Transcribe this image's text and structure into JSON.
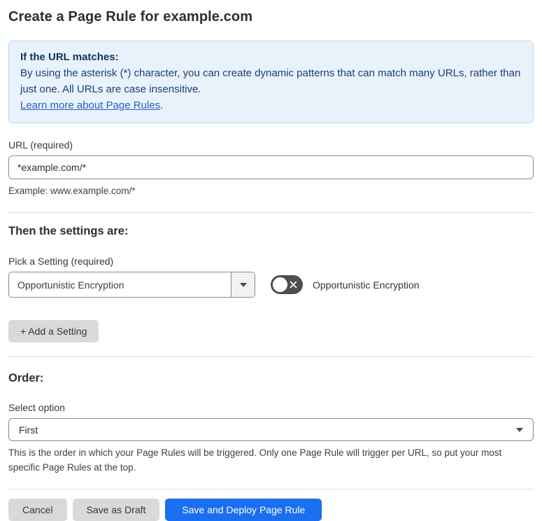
{
  "page": {
    "title": "Create a Page Rule for example.com"
  },
  "info_box": {
    "heading": "If the URL matches:",
    "body": "By using the asterisk (*) character, you can create dynamic patterns that can match many URLs, rather than just one. All URLs are case insensitive.",
    "link_label": "Learn more about Page Rules",
    "link_suffix": "."
  },
  "url_field": {
    "label": "URL (required)",
    "value": "*example.com/*",
    "helper": "Example: www.example.com/*"
  },
  "settings_section": {
    "heading": "Then the settings are:",
    "picker_label": "Pick a Setting (required)",
    "picker_value": "Opportunistic Encryption",
    "toggle_state": "off",
    "toggle_label": "Opportunistic Encryption",
    "add_button_label": "+ Add a Setting"
  },
  "order_section": {
    "heading": "Order:",
    "select_label": "Select option",
    "select_value": "First",
    "helper": "This is the order in which your Page Rules will be triggered. Only one Page Rule will trigger per URL, so put your most specific Page Rules at the top."
  },
  "footer": {
    "cancel_label": "Cancel",
    "save_draft_label": "Save as Draft",
    "save_deploy_label": "Save and Deploy Page Rule"
  },
  "colors": {
    "info_box_bg": "#e9f2fb",
    "info_box_border": "#bdd6f0",
    "info_text": "#1d3c78",
    "link_blue": "#2b5fc7",
    "primary_button_blue": "#1a6ef2",
    "gray_button": "#d9d9d9",
    "toggle_off": "#4e4e4e",
    "divider": "#dedede",
    "input_border": "#8a8a8a"
  }
}
